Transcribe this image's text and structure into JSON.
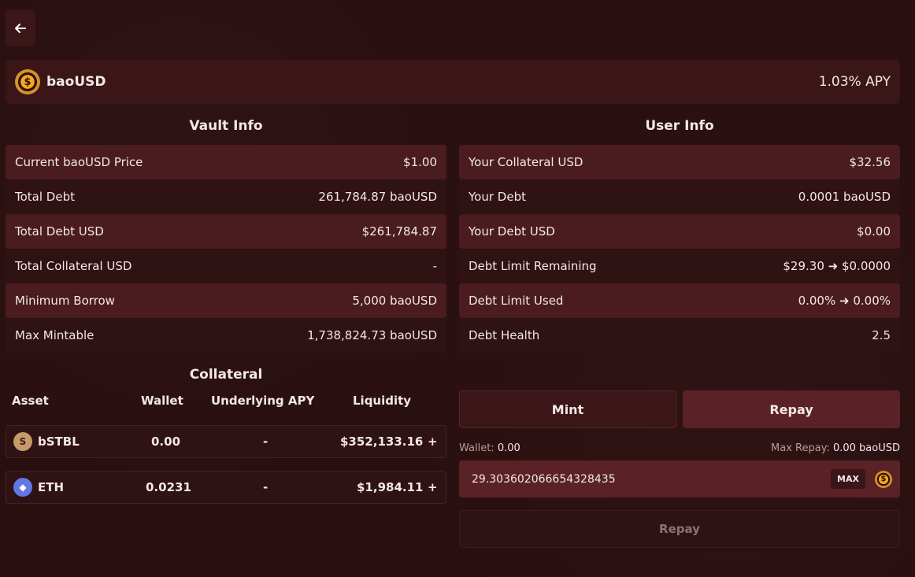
{
  "header": {
    "title": "baoUSD",
    "apy": "1.03% APY"
  },
  "vault_info": {
    "title": "Vault Info",
    "rows": [
      {
        "label": "Current baoUSD Price",
        "value": "$1.00"
      },
      {
        "label": "Total Debt",
        "value": "261,784.87 baoUSD"
      },
      {
        "label": "Total Debt USD",
        "value": "$261,784.87"
      },
      {
        "label": "Total Collateral USD",
        "value": "-"
      },
      {
        "label": "Minimum Borrow",
        "value": "5,000 baoUSD"
      },
      {
        "label": "Max Mintable",
        "value": "1,738,824.73 baoUSD"
      }
    ]
  },
  "user_info": {
    "title": "User Info",
    "rows": [
      {
        "label": "Your Collateral USD",
        "value": "$32.56"
      },
      {
        "label": "Your Debt",
        "value": "0.0001 baoUSD"
      },
      {
        "label": "Your Debt USD",
        "value": "$0.00"
      },
      {
        "label": "Debt Limit Remaining",
        "value": "$29.30 ➜ $0.0000"
      },
      {
        "label": "Debt Limit Used",
        "value": "0.00% ➜ 0.00%"
      },
      {
        "label": "Debt Health",
        "value": "2.5"
      }
    ]
  },
  "collateral": {
    "title": "Collateral",
    "headers": {
      "asset": "Asset",
      "wallet": "Wallet",
      "apy": "Underlying APY",
      "liquidity": "Liquidity"
    },
    "rows": [
      {
        "icon": "bstbl-icon",
        "glyph": "S",
        "name": "bSTBL",
        "wallet": "0.00",
        "apy": "-",
        "liquidity": "$352,133.16",
        "add": "+"
      },
      {
        "icon": "eth-icon",
        "glyph": "◆",
        "name": "ETH",
        "wallet": "0.0231",
        "apy": "-",
        "liquidity": "$1,984.11",
        "add": "+"
      }
    ]
  },
  "actions": {
    "mint_tab": "Mint",
    "repay_tab": "Repay",
    "wallet_label": "Wallet:",
    "wallet_value": "0.00",
    "max_repay_label": "Max Repay:",
    "max_repay_value": "0.00 baoUSD",
    "input_value": "29.303602066654328435",
    "max_button": "MAX",
    "submit_label": "Repay"
  },
  "icons": {
    "back": "arrow-left-icon",
    "token": "baousd-coin-icon"
  }
}
